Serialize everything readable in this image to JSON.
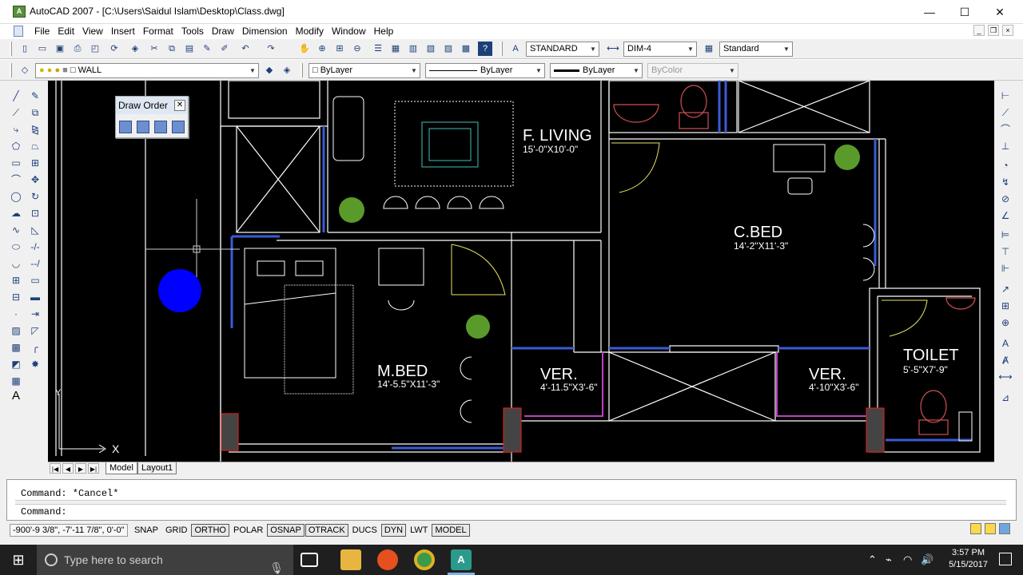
{
  "window": {
    "title": "AutoCAD 2007 - [C:\\Users\\Saidul Islam\\Desktop\\Class.dwg]",
    "app_icon_text": "A",
    "minimize_icon": "minimize-icon",
    "maximize_icon": "maximize-icon",
    "close_icon": "close-icon",
    "min_glyph": "—",
    "max_glyph": "☐",
    "close_glyph": "✕"
  },
  "menubar": {
    "items": [
      "File",
      "Edit",
      "View",
      "Insert",
      "Format",
      "Tools",
      "Draw",
      "Dimension",
      "Modify",
      "Window",
      "Help"
    ],
    "mdi_min": "_",
    "mdi_restore": "❐",
    "mdi_close": "×"
  },
  "toolbar1": {
    "text_style": "STANDARD",
    "dim_style": "DIM-4",
    "table_style": "Standard"
  },
  "toolbar2": {
    "layer": "WALL",
    "color": "ByLayer",
    "linetype": "ByLayer",
    "lineweight": "ByLayer",
    "plotstyle": "ByColor"
  },
  "draw_order": {
    "title": "Draw Order",
    "close": "✕"
  },
  "drawing": {
    "rooms": [
      {
        "name": "F. LIVING",
        "dims": "15'-0\"X10'-0\""
      },
      {
        "name": "C.BED",
        "dims": "14'-2\"X11'-3\""
      },
      {
        "name": "M.BED",
        "dims": "14'-5.5\"X11'-3\""
      },
      {
        "name": "VER.",
        "dims": "4'-11.5\"X3'-6\""
      },
      {
        "name": "VER.",
        "dims": "4'-10\"X3'-6\""
      },
      {
        "name": "TOILET",
        "dims": "5'-5\"X7'-9\""
      }
    ],
    "ucs_x": "X",
    "ucs_y": "Y",
    "colors": {
      "background": "#000000",
      "wall": "#ffffff",
      "window": "#3a5bd6",
      "door_swing": "#e8e860",
      "magenta": "#c040c0",
      "red": "#d02020",
      "plant": "#5a9a2a",
      "dot": "#0000ff"
    }
  },
  "layout_tabs": {
    "nav": [
      "|◀",
      "◀",
      "▶",
      "▶|"
    ],
    "tabs": [
      "Model",
      "Layout1"
    ]
  },
  "command": {
    "line1": "Command: *Cancel*",
    "line2": "Command:"
  },
  "statusbar": {
    "coords": "-900'-9 3/8\", -7'-11 7/8\", 0'-0\"",
    "toggles": [
      {
        "label": "SNAP",
        "on": false
      },
      {
        "label": "GRID",
        "on": false
      },
      {
        "label": "ORTHO",
        "on": true
      },
      {
        "label": "POLAR",
        "on": false
      },
      {
        "label": "OSNAP",
        "on": true
      },
      {
        "label": "OTRACK",
        "on": true
      },
      {
        "label": "DUCS",
        "on": false
      },
      {
        "label": "DYN",
        "on": true
      },
      {
        "label": "LWT",
        "on": false
      },
      {
        "label": "MODEL",
        "on": true
      }
    ]
  },
  "taskbar": {
    "search_placeholder": "Type here to search",
    "time": "3:57 PM",
    "date": "5/15/2017"
  }
}
